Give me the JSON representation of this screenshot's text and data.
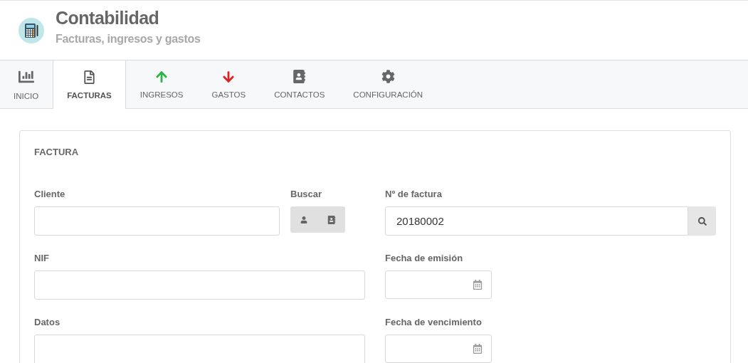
{
  "header": {
    "title": "Contabilidad",
    "subtitle": "Facturas, ingresos y gastos"
  },
  "tabs": [
    {
      "label": "INICIO",
      "kind": "chart",
      "selected": false
    },
    {
      "label": "FACTURAS",
      "kind": "document",
      "selected": true
    },
    {
      "label": "INGRESOS",
      "kind": "up",
      "selected": false
    },
    {
      "label": "GASTOS",
      "kind": "down",
      "selected": false
    },
    {
      "label": "CONTACTOS",
      "kind": "contacts",
      "selected": false
    },
    {
      "label": "CONFIGURACIÓN",
      "kind": "settings",
      "selected": false
    }
  ],
  "panel": {
    "title": "FACTURA",
    "cliente": {
      "label": "Cliente"
    },
    "buscar": {
      "label": "Buscar"
    },
    "numero": {
      "label": "Nº de factura",
      "value": "20180002"
    },
    "nif": {
      "label": "NIF"
    },
    "emision": {
      "label": "Fecha de emisión"
    },
    "datos": {
      "label": "Datos"
    },
    "vencimiento": {
      "label": "Fecha de vencimiento"
    }
  }
}
